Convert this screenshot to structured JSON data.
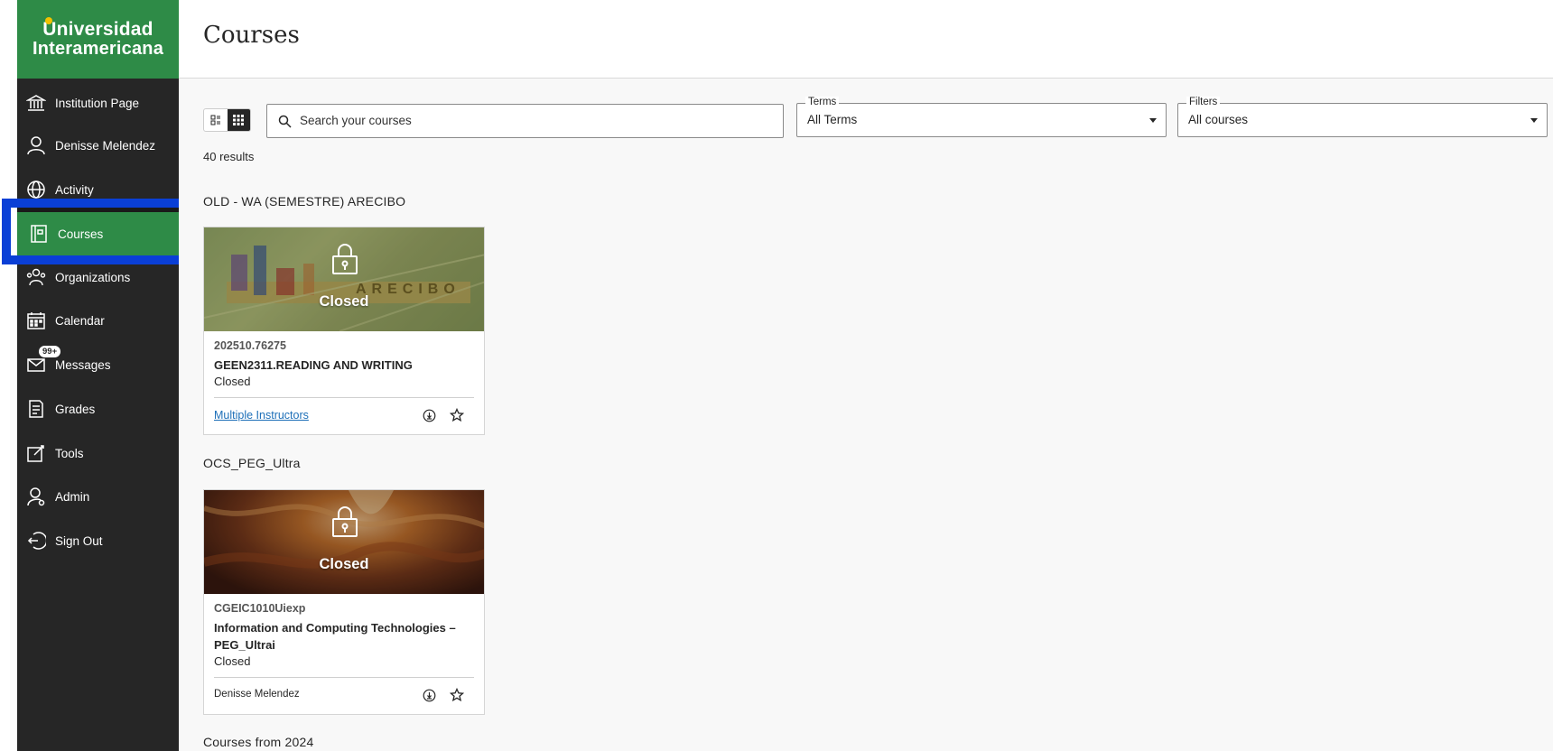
{
  "brand": {
    "line1": "Universidad",
    "line2": "Interamericana",
    "colors": {
      "primary": "#2e8b47",
      "accent": "#f2c200"
    }
  },
  "sidebar": {
    "items": [
      {
        "label": "Institution Page",
        "icon": "institution-icon"
      },
      {
        "label": "Denisse Melendez",
        "icon": "user-icon"
      },
      {
        "label": "Activity",
        "icon": "globe-icon"
      },
      {
        "label": "Courses",
        "icon": "courses-icon",
        "active": true
      },
      {
        "label": "Organizations",
        "icon": "organizations-icon"
      },
      {
        "label": "Calendar",
        "icon": "calendar-icon"
      },
      {
        "label": "Messages",
        "icon": "messages-icon",
        "badge": "99+"
      },
      {
        "label": "Grades",
        "icon": "grades-icon"
      },
      {
        "label": "Tools",
        "icon": "tools-icon"
      },
      {
        "label": "Admin",
        "icon": "admin-icon"
      },
      {
        "label": "Sign Out",
        "icon": "sign-out-icon"
      }
    ]
  },
  "main": {
    "title": "Courses",
    "search": {
      "placeholder": "Search your courses"
    },
    "terms": {
      "label": "Terms",
      "value": "All Terms"
    },
    "filters": {
      "label": "Filters",
      "value": "All courses"
    },
    "results": "40 results",
    "sections": [
      {
        "title": "OLD - WA (SEMESTRE) ARECIBO",
        "card": {
          "image_text": "Closed",
          "banner_text": "ARECIBO",
          "id": "202510.76275",
          "name": "GEEN2311.READING AND WRITING",
          "status": "Closed",
          "instructor": "Multiple Instructors"
        }
      },
      {
        "title": "OCS_PEG_Ultra",
        "card": {
          "image_text": "Closed",
          "id": "CGEIC1010Uiexp",
          "name": "Information and Computing Technologies – PEG_Ultrai",
          "status": "Closed",
          "instructor": "Denisse Melendez"
        }
      },
      {
        "title": "Courses from 2024"
      }
    ]
  }
}
